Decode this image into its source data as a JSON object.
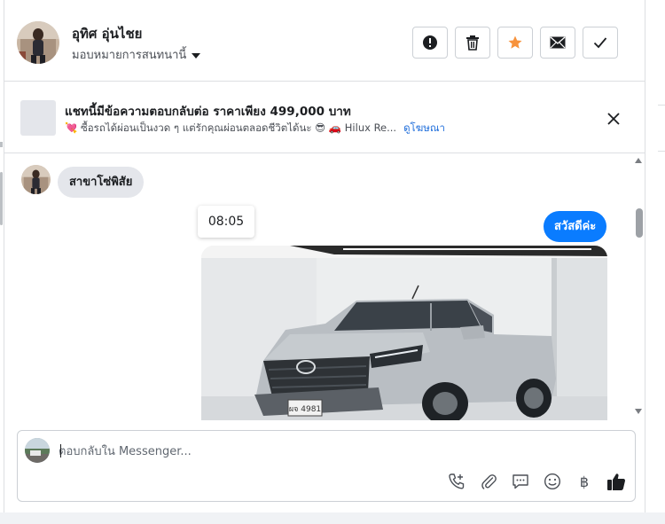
{
  "header": {
    "contact_name": "อุทิศ อุ่นไชย",
    "assign_label": "มอบหมายการสนทนานี้",
    "actions": [
      {
        "icon": "alert-icon"
      },
      {
        "icon": "trash-icon"
      },
      {
        "icon": "star-icon",
        "color": "#f7923b"
      },
      {
        "icon": "mail-icon"
      },
      {
        "icon": "check-icon"
      }
    ]
  },
  "ad_banner": {
    "title": "แชทนี้มีข้อความตอบกลับต่อ ราคาเพียง 499,000 บาท",
    "subtitle": "💘 ซื้อรถได้ผ่อนเป็นงวด ๆ แต่รักคุณผ่อนตลอดชีวิตได้นะ 😎 🚗 Hilux Re...",
    "link": "ดูโฆษณา"
  },
  "conversation": {
    "incoming_message": "สาขาโซ่พิสัย",
    "timestamp": "08:05",
    "outgoing_message": "สวัสดีค่ะ",
    "photo_plate": "ผจ 4981"
  },
  "composer": {
    "placeholder": "ตอบกลับใน Messenger...",
    "tools": [
      "call-add-icon",
      "attach-icon",
      "saved-reply-icon",
      "emoji-icon",
      "baht-icon",
      "like-icon"
    ],
    "baht_symbol": "฿"
  },
  "colors": {
    "accent": "#0a7cff",
    "link": "#216fdb",
    "star": "#f7923b"
  }
}
